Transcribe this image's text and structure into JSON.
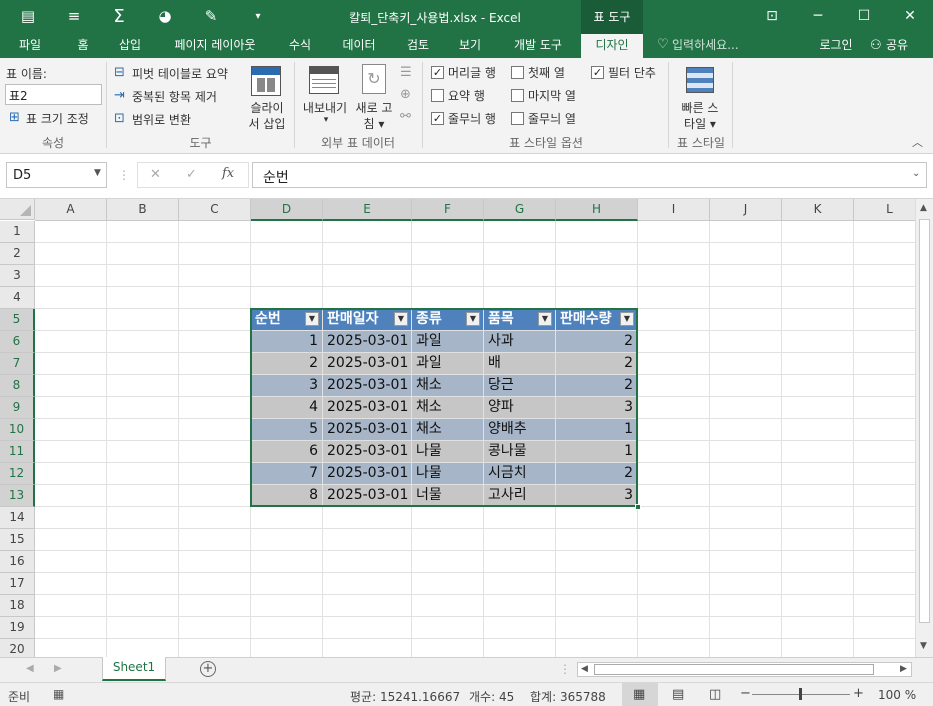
{
  "window": {
    "title": "칼퇴_단축키_사용법.xlsx - Excel",
    "context_tab_group": "표 도구",
    "minimize_glyph": "─",
    "maximize_glyph": "☐",
    "close_glyph": "✕",
    "ribbon_display_glyph": "⊡",
    "qat_customize_glyph": "▾"
  },
  "tabs": [
    "파일",
    "홈",
    "삽입",
    "페이지 레이아웃",
    "수식",
    "데이터",
    "검토",
    "보기",
    "개발 도구",
    "디자인"
  ],
  "active_tab": "디자인",
  "tell_me": "입력하세요...",
  "login": "로그인",
  "share": "공유",
  "ribbon": {
    "properties": {
      "table_name_label": "표 이름:",
      "table_name_value": "표2",
      "resize": "표 크기 조정",
      "group": "속성"
    },
    "tools": {
      "pivot": "피벗 테이블로 요약",
      "remove_dup": "중복된 항목 제거",
      "convert_range": "범위로 변환",
      "slicer_line1": "슬라이",
      "slicer_line2": "서 삽입",
      "group": "도구"
    },
    "external": {
      "export_line1": "내보내기",
      "export_line2": "▾",
      "refresh_line1": "새로 고",
      "refresh_line2": "침 ▾",
      "group": "외부 표 데이터"
    },
    "style_options": {
      "header_row": "머리글 행",
      "total_row": "요약 행",
      "banded_rows": "줄무늬 행",
      "first_col": "첫째 열",
      "last_col": "마지막 열",
      "banded_cols": "줄무늬 열",
      "filter_btn": "필터 단추",
      "group": "표 스타일 옵션"
    },
    "table_styles": {
      "quick_styles_line1": "빠른 스",
      "quick_styles_line2": "타일 ▾",
      "group": "표 스타일"
    }
  },
  "formula_bar": {
    "name_box": "D5",
    "cancel": "✕",
    "enter": "✓",
    "fx": "fx",
    "content": "순번"
  },
  "columns": [
    "A",
    "B",
    "C",
    "D",
    "E",
    "F",
    "G",
    "H",
    "I",
    "J",
    "K",
    "L"
  ],
  "rows": [
    "1",
    "2",
    "3",
    "4",
    "5",
    "6",
    "7",
    "8",
    "9",
    "10",
    "11",
    "12",
    "13",
    "14",
    "15",
    "16",
    "17",
    "18",
    "19",
    "20"
  ],
  "table": {
    "headers": [
      "순번",
      "판매일자",
      "종류",
      "품목",
      "판매수량"
    ],
    "rows": [
      [
        "1",
        "2025-03-01",
        "과일",
        "사과",
        "2"
      ],
      [
        "2",
        "2025-03-01",
        "과일",
        "배",
        "2"
      ],
      [
        "3",
        "2025-03-01",
        "채소",
        "당근",
        "2"
      ],
      [
        "4",
        "2025-03-01",
        "채소",
        "양파",
        "3"
      ],
      [
        "5",
        "2025-03-01",
        "채소",
        "양배추",
        "1"
      ],
      [
        "6",
        "2025-03-01",
        "나물",
        "콩나물",
        "1"
      ],
      [
        "7",
        "2025-03-01",
        "나물",
        "시금치",
        "2"
      ],
      [
        "8",
        "2025-03-01",
        "너물",
        "고사리",
        "3"
      ]
    ],
    "header_color": "#4f81bd",
    "band_dark": "#a6b5c7",
    "band_light": "#c6c6c6"
  },
  "sheet_tab": "Sheet1",
  "status": {
    "ready": "준비",
    "average": "평균: 15241.16667",
    "count": "개수: 45",
    "sum": "합계: 365788",
    "zoom": "100 %"
  },
  "colors": {
    "excel_green": "#217346"
  }
}
